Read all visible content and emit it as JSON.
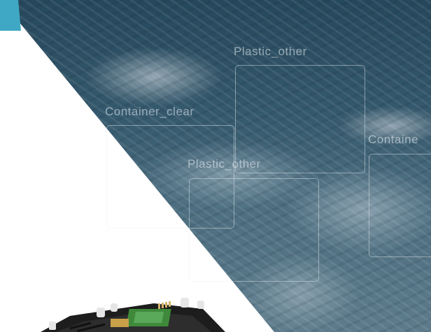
{
  "detections": [
    {
      "label": "Plastic_other"
    },
    {
      "label": "Container_clear"
    },
    {
      "label": "Plastic_other"
    },
    {
      "label": "Containe"
    }
  ],
  "colors": {
    "accent": "#3fa8c4",
    "photo_dark": "#26485c",
    "box_stroke": "#ebf0f5"
  },
  "icons": {
    "board": "circuit-board-icon"
  }
}
